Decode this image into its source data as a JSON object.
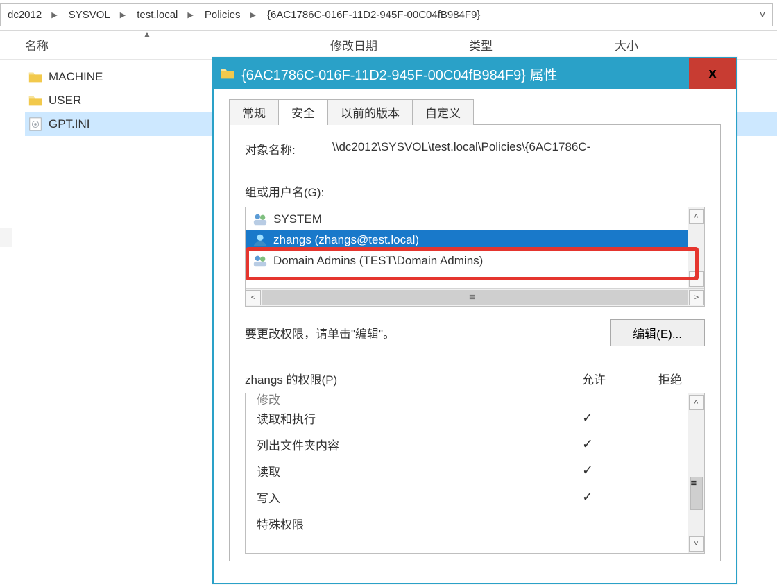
{
  "breadcrumb": [
    "dc2012",
    "SYSVOL",
    "test.local",
    "Policies",
    "{6AC1786C-016F-11D2-945F-00C04fB984F9}"
  ],
  "columns": {
    "name": "名称",
    "date": "修改日期",
    "type": "类型",
    "size": "大小"
  },
  "files": [
    {
      "name": "MACHINE",
      "kind": "folder",
      "selected": false
    },
    {
      "name": "USER",
      "kind": "folder",
      "selected": false
    },
    {
      "name": "GPT.INI",
      "kind": "ini",
      "selected": true
    }
  ],
  "dialog": {
    "title": "{6AC1786C-016F-11D2-945F-00C04fB984F9} 属性",
    "close": "x",
    "tabs": {
      "general": "常规",
      "security": "安全",
      "previous": "以前的版本",
      "custom": "自定义"
    },
    "object_label": "对象名称:",
    "object_value": "\\\\dc2012\\SYSVOL\\test.local\\Policies\\{6AC1786C-",
    "group_label": "组或用户名(G):",
    "groups": [
      {
        "name": "SYSTEM",
        "icon": "group",
        "selected": false
      },
      {
        "name": "zhangs (zhangs@test.local)",
        "icon": "user",
        "selected": true
      },
      {
        "name": "Domain Admins (TEST\\Domain Admins)",
        "icon": "group",
        "selected": false
      }
    ],
    "edit_hint": "要更改权限，请单击\"编辑\"。",
    "edit_btn": "编辑(E)...",
    "perm_label": "zhangs 的权限(P)",
    "allow": "允许",
    "deny": "拒绝",
    "permissions": [
      {
        "name": "修改",
        "allow": false,
        "cut": true
      },
      {
        "name": "读取和执行",
        "allow": true
      },
      {
        "name": "列出文件夹内容",
        "allow": true
      },
      {
        "name": "读取",
        "allow": true
      },
      {
        "name": "写入",
        "allow": true
      },
      {
        "name": "特殊权限",
        "allow": false
      }
    ]
  }
}
